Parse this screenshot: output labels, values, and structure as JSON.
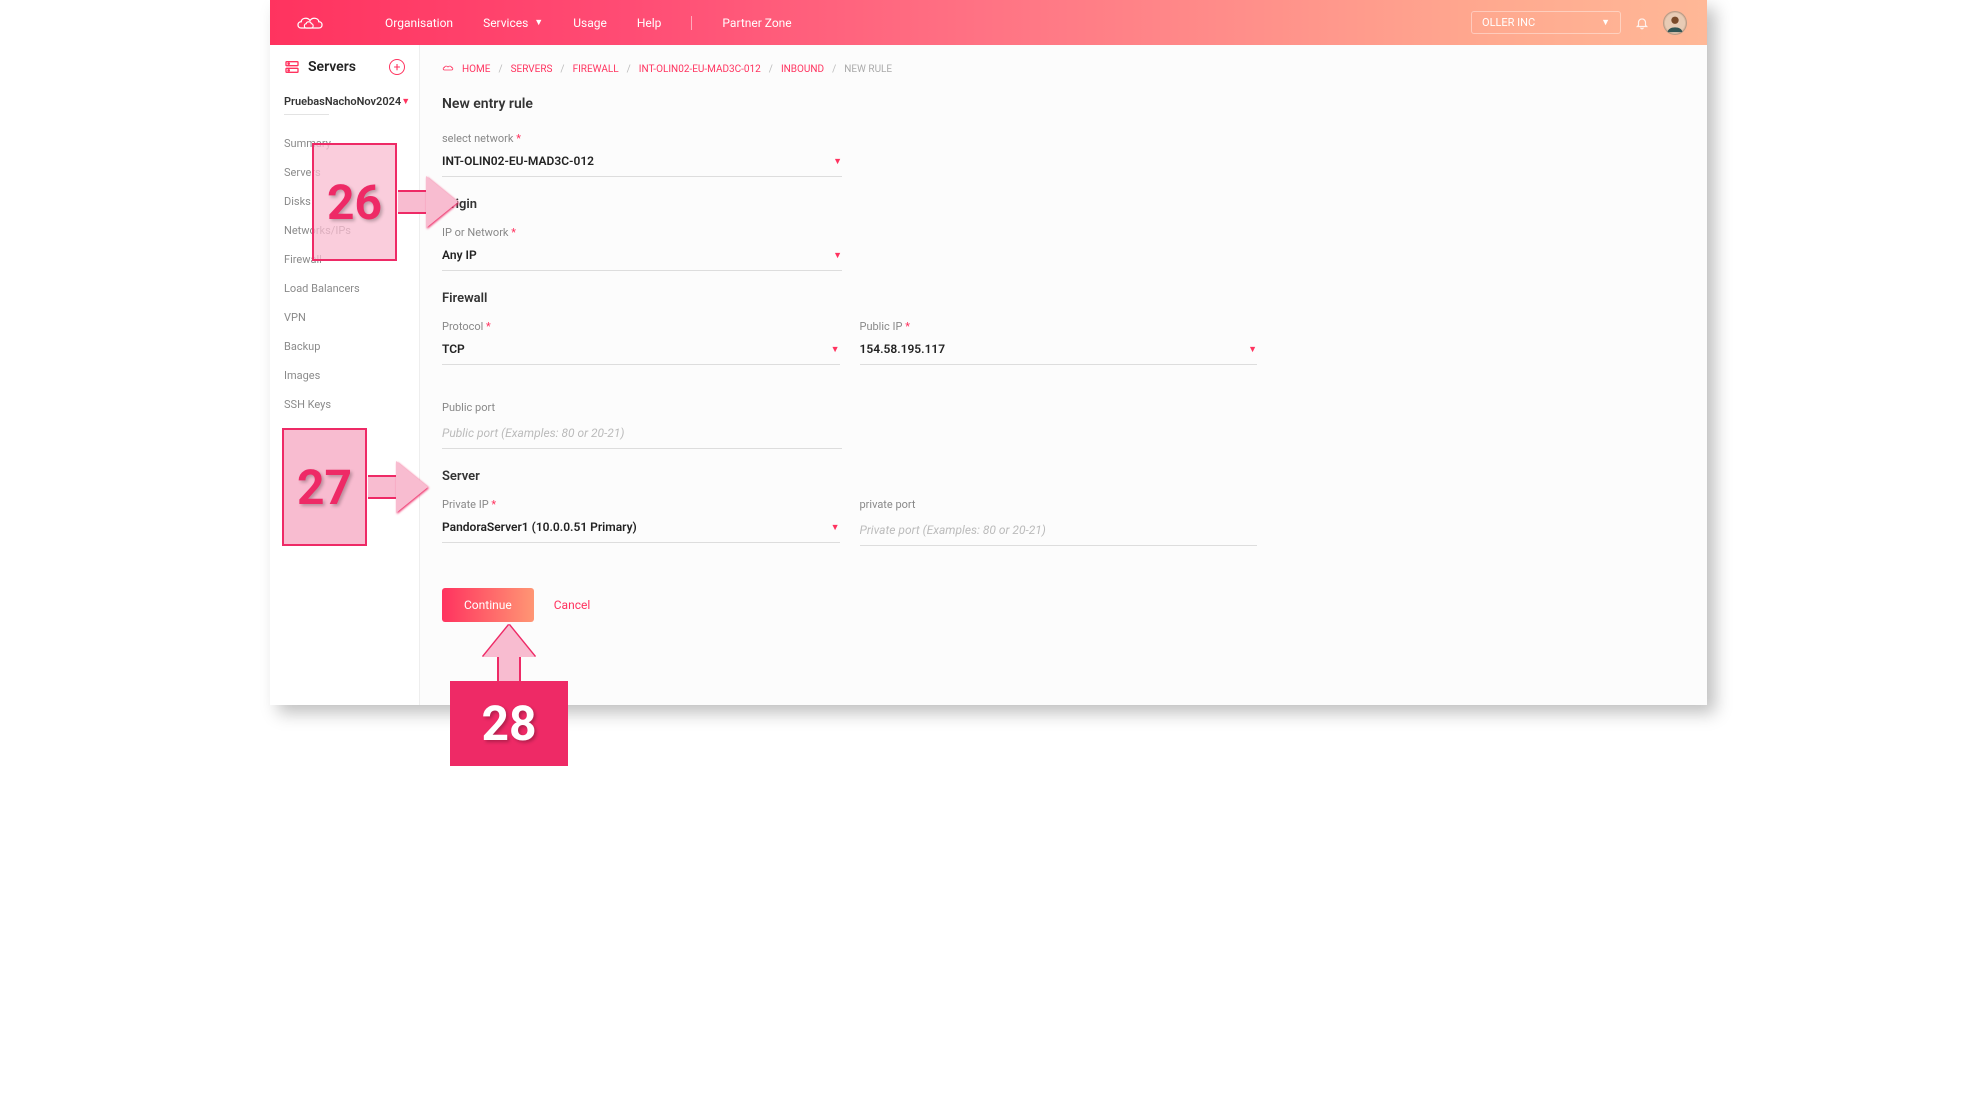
{
  "header": {
    "nav": {
      "organisation": "Organisation",
      "services": "Services",
      "usage": "Usage",
      "help": "Help",
      "partner": "Partner Zone"
    },
    "org_selected": "OLLER INC"
  },
  "sidebar": {
    "title": "Servers",
    "project": "PruebasNachoNov2024",
    "items": [
      "Summary",
      "Servers",
      "Disks",
      "Networks/IPs",
      "Firewall",
      "Load Balancers",
      "VPN",
      "Backup",
      "Images",
      "SSH Keys"
    ]
  },
  "breadcrumb": {
    "home": "HOME",
    "servers": "SERVERS",
    "firewall": "FIREWALL",
    "network": "INT-OLIN02-EU-MAD3C-012",
    "inbound": "INBOUND",
    "current": "NEW RULE"
  },
  "page": {
    "title": "New entry rule",
    "network_label": "select network",
    "network_value": "INT-OLIN02-EU-MAD3C-012",
    "origin_title": "Origin",
    "origin_ip_label": "IP or Network",
    "origin_ip_value": "Any IP",
    "firewall_title": "Firewall",
    "protocol_label": "Protocol",
    "protocol_value": "TCP",
    "public_ip_label": "Public IP",
    "public_ip_value": "154.58.195.117",
    "public_port_label": "Public port",
    "public_port_placeholder": "Public port (Examples: 80 or 20-21)",
    "server_title": "Server",
    "private_ip_label": "Private IP",
    "private_ip_value": "PandoraServer1 (10.0.0.51 Primary)",
    "private_port_label": "private port",
    "private_port_placeholder": "Private port (Examples: 80 or 20-21)",
    "continue": "Continue",
    "cancel": "Cancel"
  },
  "annotations": {
    "a26": "26",
    "a27": "27",
    "a28": "28"
  }
}
